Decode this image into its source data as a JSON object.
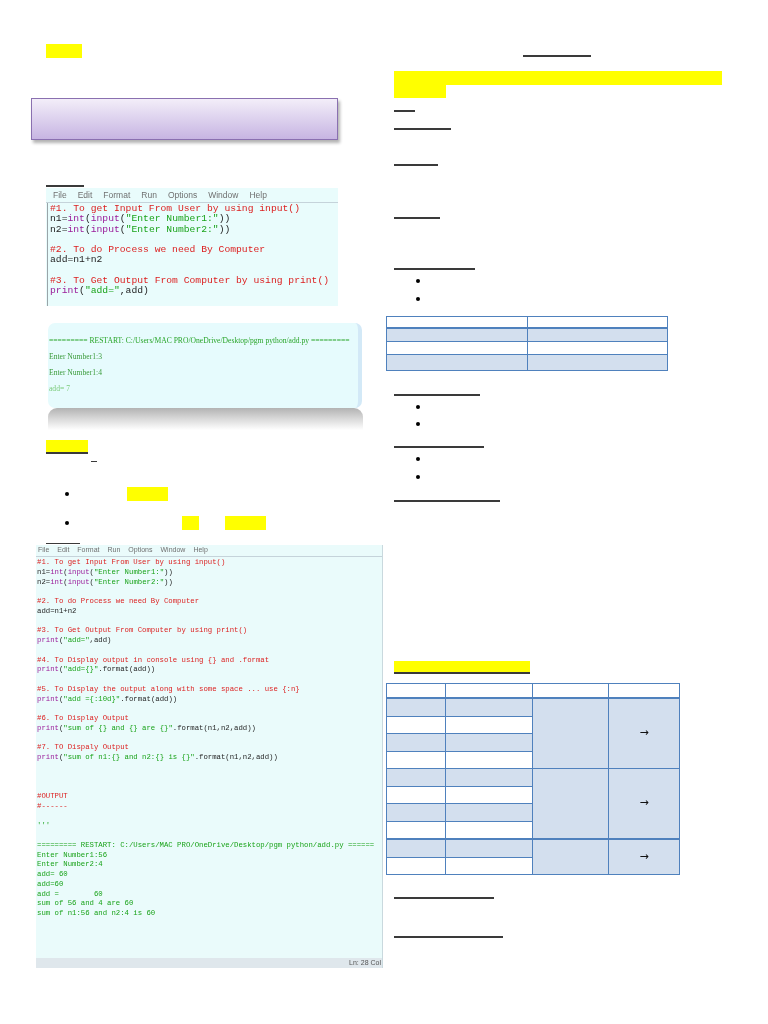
{
  "left_column": {
    "editor_1": {
      "menu": [
        "File",
        "Edit",
        "Format",
        "Run",
        "Options",
        "Window",
        "Help"
      ],
      "code_blocks": [
        [
          [
            {
              "kind": "comment",
              "text": "#1. To get Input From User by using input()"
            }
          ],
          [
            {
              "kind": "plain",
              "text": "n1="
            },
            {
              "kind": "builtin",
              "text": "int"
            },
            {
              "kind": "plain",
              "text": "("
            },
            {
              "kind": "builtin",
              "text": "input"
            },
            {
              "kind": "plain",
              "text": "("
            },
            {
              "kind": "string",
              "text": "\"Enter Number1:\""
            },
            {
              "kind": "plain",
              "text": "))"
            }
          ],
          [
            {
              "kind": "plain",
              "text": "n2="
            },
            {
              "kind": "builtin",
              "text": "int"
            },
            {
              "kind": "plain",
              "text": "("
            },
            {
              "kind": "builtin",
              "text": "input"
            },
            {
              "kind": "plain",
              "text": "("
            },
            {
              "kind": "string",
              "text": "\"Enter Number2:\""
            },
            {
              "kind": "plain",
              "text": "))"
            }
          ]
        ],
        [
          [
            {
              "kind": "comment",
              "text": "#2. To do Process we need By Computer"
            }
          ],
          [
            {
              "kind": "plain",
              "text": "add=n1+n2"
            }
          ]
        ],
        [
          [
            {
              "kind": "comment",
              "text": "#3. To Get Output From Computer by using print()"
            }
          ],
          [
            {
              "kind": "builtin",
              "text": "print"
            },
            {
              "kind": "plain",
              "text": "("
            },
            {
              "kind": "string",
              "text": "\"add=\""
            },
            {
              "kind": "plain",
              "text": ",add)"
            }
          ]
        ]
      ]
    },
    "console": {
      "lines": [
        {
          "kind": "restart",
          "text": "========= RESTART: C:/Users/MAC PRO/OneDrive/Desktop/pgm python/add.py ========="
        },
        {
          "kind": "input",
          "text": "Enter Number1:3"
        },
        {
          "kind": "input",
          "text": "Enter Number1:4"
        },
        {
          "kind": "result",
          "text": "add= 7"
        }
      ]
    },
    "editor_2": {
      "menu": [
        "File",
        "Edit",
        "Format",
        "Run",
        "Options",
        "Window",
        "Help"
      ],
      "code_blocks": [
        [
          [
            {
              "kind": "comment",
              "text": "#1. To get Input From User by using input()"
            }
          ],
          [
            {
              "kind": "plain",
              "text": "n1="
            },
            {
              "kind": "builtin",
              "text": "int"
            },
            {
              "kind": "plain",
              "text": "("
            },
            {
              "kind": "builtin",
              "text": "input"
            },
            {
              "kind": "plain",
              "text": "("
            },
            {
              "kind": "string",
              "text": "\"Enter Number1:\""
            },
            {
              "kind": "plain",
              "text": "))"
            }
          ],
          [
            {
              "kind": "plain",
              "text": "n2="
            },
            {
              "kind": "builtin",
              "text": "int"
            },
            {
              "kind": "plain",
              "text": "("
            },
            {
              "kind": "builtin",
              "text": "input"
            },
            {
              "kind": "plain",
              "text": "("
            },
            {
              "kind": "string",
              "text": "\"Enter Number2:\""
            },
            {
              "kind": "plain",
              "text": "))"
            }
          ]
        ],
        [
          [
            {
              "kind": "comment",
              "text": "#2. To do Process we need By Computer"
            }
          ],
          [
            {
              "kind": "plain",
              "text": "add=n1+n2"
            }
          ]
        ],
        [
          [
            {
              "kind": "comment",
              "text": "#3. To Get Output From Computer by using print()"
            }
          ],
          [
            {
              "kind": "builtin",
              "text": "print"
            },
            {
              "kind": "plain",
              "text": "("
            },
            {
              "kind": "string",
              "text": "\"add=\""
            },
            {
              "kind": "plain",
              "text": ",add)"
            }
          ]
        ],
        [
          [
            {
              "kind": "comment",
              "text": "#4. To Display output in console using {} and .format"
            }
          ],
          [
            {
              "kind": "builtin",
              "text": "print"
            },
            {
              "kind": "plain",
              "text": "("
            },
            {
              "kind": "string",
              "text": "\"add={}\""
            },
            {
              "kind": "plain",
              "text": ".format(add))"
            }
          ]
        ],
        [
          [
            {
              "kind": "comment",
              "text": "#5. To Display the output along with some space ... use {:n}"
            }
          ],
          [
            {
              "kind": "builtin",
              "text": "print"
            },
            {
              "kind": "plain",
              "text": "("
            },
            {
              "kind": "string",
              "text": "\"add ={:10d}\""
            },
            {
              "kind": "plain",
              "text": ".format(add))"
            }
          ]
        ],
        [
          [
            {
              "kind": "comment",
              "text": "#6. To Display Output"
            }
          ],
          [
            {
              "kind": "builtin",
              "text": "print"
            },
            {
              "kind": "plain",
              "text": "("
            },
            {
              "kind": "string",
              "text": "\"sum of {} and {} are {}\""
            },
            {
              "kind": "plain",
              "text": ".format(n1,n2,add))"
            }
          ]
        ],
        [
          [
            {
              "kind": "comment",
              "text": "#7. TO Dispaly Output"
            }
          ],
          [
            {
              "kind": "builtin",
              "text": "print"
            },
            {
              "kind": "plain",
              "text": "("
            },
            {
              "kind": "string",
              "text": "\"sum of n1:{} and n2:{} is {}\""
            },
            {
              "kind": "plain",
              "text": ".format(n1,n2,add))"
            }
          ]
        ]
      ],
      "output_blocks": [
        [
          [
            {
              "kind": "comment",
              "text": "#OUTPUT"
            }
          ],
          [
            {
              "kind": "comment",
              "text": "#------"
            }
          ]
        ],
        [
          [
            {
              "kind": "string",
              "text": "'''"
            }
          ]
        ],
        [
          [
            {
              "kind": "string",
              "text": "========= RESTART: C:/Users/MAC PRO/OneDrive/Desktop/pgm python/add.py ======"
            }
          ],
          [
            {
              "kind": "string",
              "text": "Enter Number1:56"
            }
          ],
          [
            {
              "kind": "string",
              "text": "Enter Number2:4"
            }
          ],
          [
            {
              "kind": "string",
              "text": "add= 60"
            }
          ],
          [
            {
              "kind": "string",
              "text": "add=60"
            }
          ],
          [
            {
              "kind": "string",
              "text": "add =        60"
            }
          ],
          [
            {
              "kind": "string",
              "text": "sum of 56 and 4 are 60"
            }
          ],
          [
            {
              "kind": "string",
              "text": "sum of n1:56 and n2:4 is 60"
            }
          ]
        ]
      ],
      "status_bar": "Ln: 28 Col"
    }
  },
  "right_column": {
    "table_2": {
      "merged_cells": [
        {
          "arrow": "→"
        },
        {
          "arrow": "→"
        },
        {
          "arrow": "→"
        }
      ]
    }
  }
}
